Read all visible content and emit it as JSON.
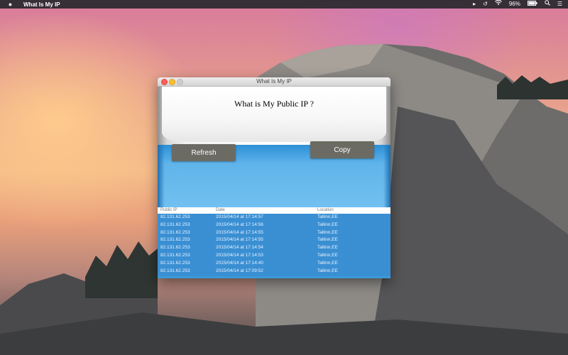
{
  "menubar": {
    "app_name": "What Is My IP",
    "battery": "96%",
    "icons": [
      "apple-icon",
      "airplay-icon",
      "time-machine-icon",
      "wifi-icon",
      "battery-icon",
      "search-icon",
      "notification-list-icon"
    ]
  },
  "window": {
    "title": "What Is My IP",
    "heading": "What is My Public IP ?",
    "buttons": {
      "refresh": "Refresh",
      "copy": "Copy"
    },
    "table": {
      "headers": {
        "ip": "Public IP",
        "date": "Date",
        "location": "Location"
      },
      "rows": [
        {
          "ip": "82.131.62.253",
          "date": "2015/04/14 at 17:14:57",
          "location": "Tallinn,EE"
        },
        {
          "ip": "82.131.62.253",
          "date": "2015/04/14 at 17:14:56",
          "location": "Tallinn,EE"
        },
        {
          "ip": "82.131.62.253",
          "date": "2015/04/14 at 17:14:55",
          "location": "Tallinn,EE"
        },
        {
          "ip": "82.131.62.253",
          "date": "2015/04/14 at 17:14:55",
          "location": "Tallinn,EE"
        },
        {
          "ip": "82.131.62.253",
          "date": "2015/04/14 at 17:14:54",
          "location": "Tallinn,EE"
        },
        {
          "ip": "82.131.62.253",
          "date": "2015/04/14 at 17:14:53",
          "location": "Tallinn,EE"
        },
        {
          "ip": "82.131.62.253",
          "date": "2015/04/14 at 17:14:40",
          "location": "Tallinn,EE"
        },
        {
          "ip": "82.131.62.253",
          "date": "2015/04/14 at 17:09:52",
          "location": "Tallinn,EE"
        }
      ]
    }
  }
}
